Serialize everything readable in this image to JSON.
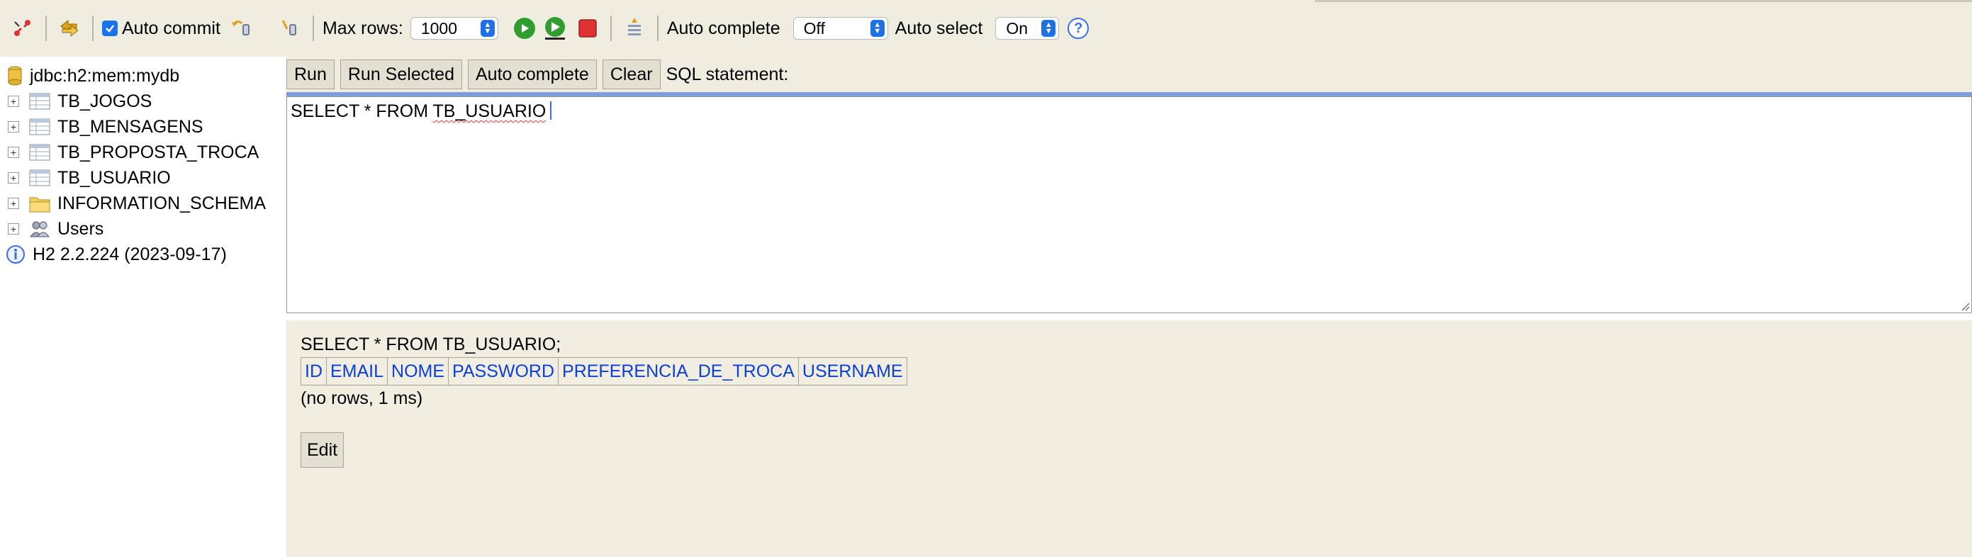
{
  "toolbar": {
    "auto_commit_label": "Auto commit",
    "auto_commit_checked": true,
    "max_rows_label": "Max rows:",
    "max_rows_value": "1000",
    "auto_complete_label": "Auto complete",
    "auto_complete_value": "Off",
    "auto_select_label": "Auto select",
    "auto_select_value": "On",
    "help_glyph": "?"
  },
  "tree": {
    "connection": "jdbc:h2:mem:mydb",
    "items": [
      {
        "label": "TB_JOGOS",
        "icon": "table-icon"
      },
      {
        "label": "TB_MENSAGENS",
        "icon": "table-icon"
      },
      {
        "label": "TB_PROPOSTA_TROCA",
        "icon": "table-icon"
      },
      {
        "label": "TB_USUARIO",
        "icon": "table-icon"
      },
      {
        "label": "INFORMATION_SCHEMA",
        "icon": "folder-icon"
      },
      {
        "label": "Users",
        "icon": "users-icon"
      }
    ],
    "version": "H2 2.2.224 (2023-09-17)"
  },
  "query_bar": {
    "run": "Run",
    "run_selected": "Run Selected",
    "auto_complete": "Auto complete",
    "clear": "Clear",
    "sql_statement_label": "SQL statement:"
  },
  "editor": {
    "sql_prefix": "SELECT * FROM ",
    "sql_table": "TB_USUARIO"
  },
  "result": {
    "sql": "SELECT * FROM TB_USUARIO;",
    "columns": [
      "ID",
      "EMAIL",
      "NOME",
      "PASSWORD",
      "PREFERENCIA_DE_TROCA",
      "USERNAME"
    ],
    "info": "(no rows, 1 ms)",
    "edit": "Edit"
  },
  "colors": {
    "panel_bg": "#efece0",
    "accent_blue": "#1f6fe5",
    "column_link": "#0b3fd9",
    "editor_rule": "#7d9edb"
  }
}
